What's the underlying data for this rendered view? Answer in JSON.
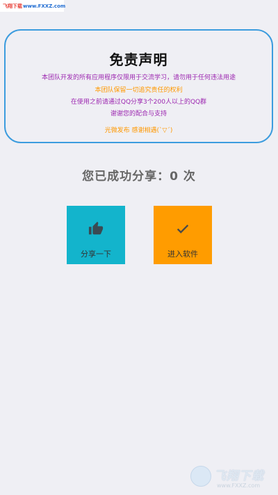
{
  "watermark_top": {
    "brand": "飞翔下载",
    "url": "www.FXXZ.com"
  },
  "disclaimer": {
    "title": "免责声明",
    "lines": [
      "本团队开发的所有应用程序仅限用于交流学习，请勿用于任何违法用途",
      "本团队保留一切追究责任的权利",
      "在使用之前请通过QQ分享3个200人以上的QQ群",
      "谢谢您的配合与支持",
      "光微发布 感谢相遇(ˋ▽ˊ)"
    ]
  },
  "share_count_text": "您已成功分享：0 次",
  "buttons": {
    "share": {
      "label": "分享一下",
      "icon": "thumbs-up-icon",
      "color": "#13b4cc"
    },
    "enter": {
      "label": "进入软件",
      "icon": "checkmark-icon",
      "color": "#ff9c00"
    }
  },
  "watermark_bottom": {
    "brand": "飞翔下载",
    "url": "www.FXXZ.com"
  },
  "colors": {
    "background": "#efeff4",
    "card_border": "#3c9cde",
    "purple_text": "#9c27b0",
    "orange_text": "#ff9800"
  }
}
